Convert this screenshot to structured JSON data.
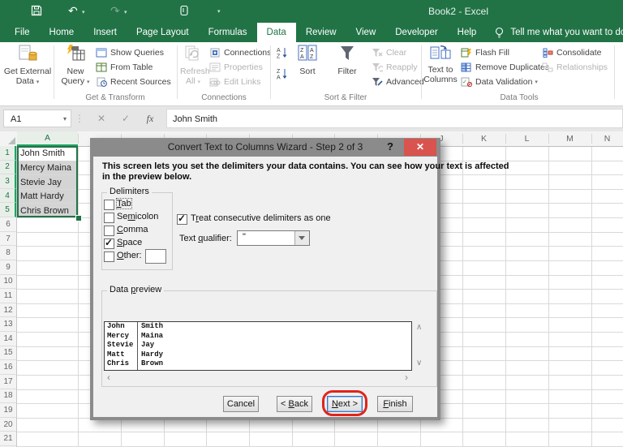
{
  "titlebar": {
    "title": "Book2 - Excel"
  },
  "tabs": [
    {
      "label": "File"
    },
    {
      "label": "Home"
    },
    {
      "label": "Insert"
    },
    {
      "label": "Page Layout"
    },
    {
      "label": "Formulas"
    },
    {
      "label": "Data"
    },
    {
      "label": "Review"
    },
    {
      "label": "View"
    },
    {
      "label": "Developer"
    },
    {
      "label": "Help"
    }
  ],
  "tellme": "Tell me what you want to do",
  "ribbon": {
    "get_external": {
      "line1": "Get External",
      "line2": "Data"
    },
    "new_query": {
      "line1": "New",
      "line2": "Query"
    },
    "show_queries": "Show Queries",
    "from_table": "From Table",
    "recent_sources": "Recent Sources",
    "group1_label": "Get & Transform",
    "refresh": {
      "line1": "Refresh",
      "line2": "All"
    },
    "connections": "Connections",
    "properties": "Properties",
    "edit_links": "Edit Links",
    "group2_label": "Connections",
    "sort": "Sort",
    "filter": "Filter",
    "clear": "Clear",
    "reapply": "Reapply",
    "advanced": "Advanced",
    "group3_label": "Sort & Filter",
    "text_to_columns": {
      "line1": "Text to",
      "line2": "Columns"
    },
    "flash_fill": "Flash Fill",
    "remove_duplicates": "Remove Duplicates",
    "data_validation": "Data Validation",
    "consolidate": "Consolidate",
    "relationships": "Relationships",
    "group4_label": "Data Tools"
  },
  "formula_bar": {
    "name_box": "A1",
    "fx": "fx",
    "value": "John Smith"
  },
  "grid": {
    "col_a": "A",
    "right_cols": [
      "J",
      "K",
      "L",
      "M",
      "N"
    ],
    "rows": [
      "1",
      "2",
      "3",
      "4",
      "5",
      "6",
      "7",
      "8",
      "9",
      "10",
      "11",
      "12",
      "13",
      "14",
      "15",
      "16",
      "17",
      "18",
      "19",
      "20",
      "21"
    ],
    "names": [
      "John Smith",
      "Mercy Maina",
      "Stevie Jay",
      "Matt Hardy",
      "Chris Brown"
    ]
  },
  "dialog": {
    "title": "Convert Text to Columns Wizard - Step 2 of 3",
    "help": "?",
    "close": "✕",
    "desc_line1": "This screen lets you set the delimiters your data contains.  You can see how your text is affected",
    "desc_line2": "in the preview below.",
    "delimiters_label": "Delimiters",
    "options": [
      {
        "pre": "",
        "u": "T",
        "rest": "ab",
        "checked": false
      },
      {
        "pre": "Se",
        "u": "m",
        "rest": "icolon",
        "checked": false
      },
      {
        "pre": "",
        "u": "C",
        "rest": "omma",
        "checked": false
      },
      {
        "pre": "",
        "u": "S",
        "rest": "pace",
        "checked": true
      },
      {
        "pre": "",
        "u": "O",
        "rest": "ther:",
        "checked": false
      }
    ],
    "treat": {
      "pre": "T",
      "u": "r",
      "rest": "eat consecutive delimiters as one",
      "checked": true
    },
    "qualifier": {
      "pre": "Text ",
      "u": "q",
      "rest": "ualifier:",
      "value": "\""
    },
    "preview_label": {
      "pre": "Data ",
      "u": "p",
      "rest": "review"
    },
    "preview_rows": [
      {
        "c1": "John",
        "c2": "Smith"
      },
      {
        "c1": "Mercy",
        "c2": "Maina"
      },
      {
        "c1": "Stevie",
        "c2": "Jay"
      },
      {
        "c1": "Matt",
        "c2": "Hardy"
      },
      {
        "c1": "Chris",
        "c2": "Brown"
      }
    ],
    "buttons": {
      "cancel": {
        "pre": "Cancel",
        "u": "",
        "rest": ""
      },
      "back": {
        "pre": "< ",
        "u": "B",
        "rest": "ack"
      },
      "next": {
        "pre": "",
        "u": "N",
        "rest": "ext >"
      },
      "finish": {
        "pre": "",
        "u": "F",
        "rest": "inish"
      }
    }
  },
  "colors": {
    "excel_green": "#217346",
    "selection_green": "#21a366",
    "dialog_title_gray": "#8b8b8b",
    "close_red": "#d9544e",
    "annotation_red": "#e0241b",
    "selected_cell_gray": "#d4d4d4"
  }
}
